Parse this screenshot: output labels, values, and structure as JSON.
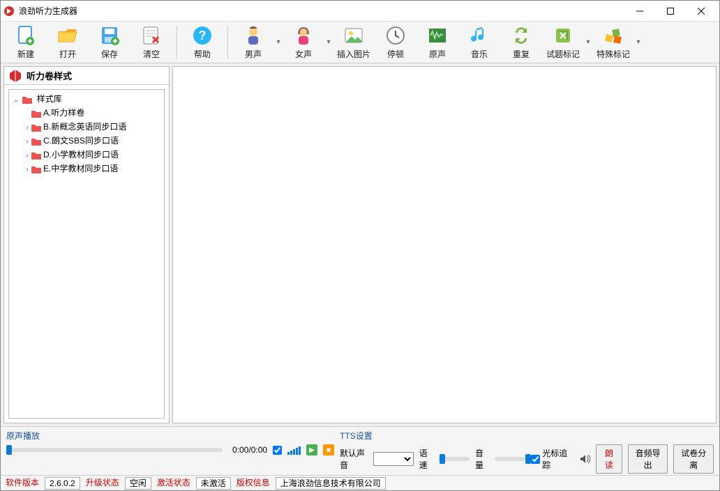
{
  "window": {
    "title": "浪劲听力生成器"
  },
  "toolbar": {
    "new": "新建",
    "open": "打开",
    "save": "保存",
    "clear": "清空",
    "help": "帮助",
    "male": "男声",
    "female": "女声",
    "insertpic": "插入图片",
    "pause": "停顿",
    "original": "原声",
    "music": "音乐",
    "repeat": "重复",
    "testmark": "试题标记",
    "specialmark": "特殊标记"
  },
  "side": {
    "header": "听力卷样式",
    "root": "样式库",
    "items": [
      "A.听力样卷",
      "B.新概念英语同步口语",
      "C.朗文SBS同步口语",
      "D.小学教材同步口语",
      "E.中学教材同步口语"
    ]
  },
  "player": {
    "section": "原声播放",
    "time": "0:00/0:00"
  },
  "tts": {
    "section": "TTS设置",
    "voice_label": "默认声音",
    "speed_label": "语速",
    "volume_label": "音量",
    "cursor_track": "光标追踪",
    "read": "朗读",
    "export": "音频导出",
    "split": "试卷分离"
  },
  "status": {
    "ver_k": "软件版本",
    "ver_v": "2.6.0.2",
    "upg_k": "升级状态",
    "upg_v": "空闲",
    "act_k": "激活状态",
    "act_v": "未激活",
    "copy_k": "版权信息",
    "copy_v": "上海浪劲信息技术有限公司"
  }
}
